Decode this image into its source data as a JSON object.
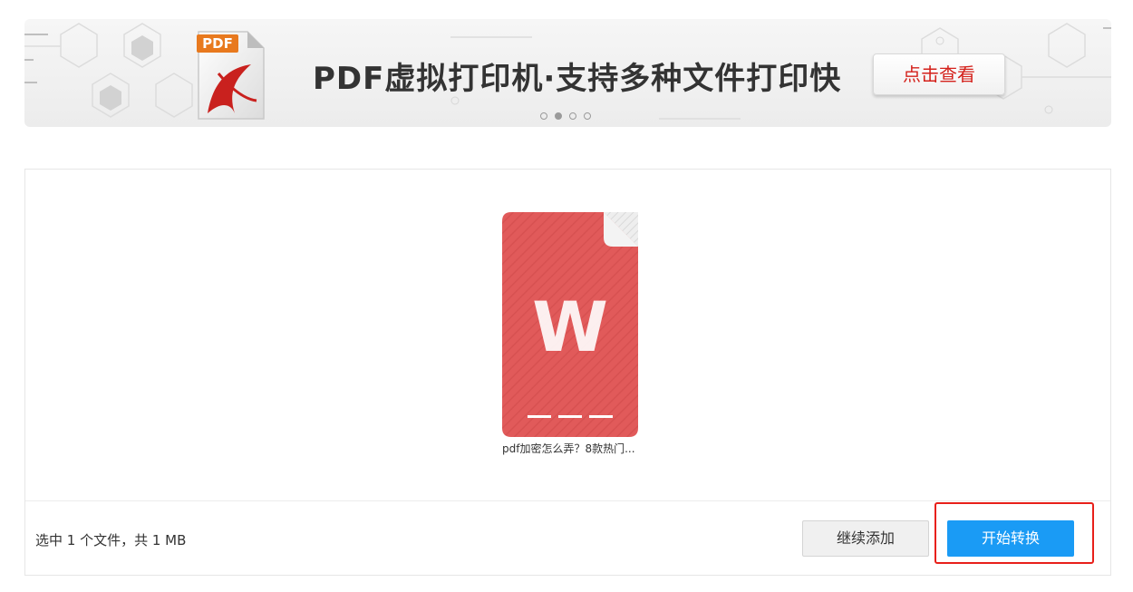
{
  "banner": {
    "title": "PDF虚拟打印机·支持多种文件打印快",
    "button_label": "点击查看",
    "icon_badge": "PDF",
    "carousel": {
      "count": 4,
      "active_index": 1
    }
  },
  "file": {
    "icon_letter": "W",
    "name": "pdf加密怎么弄？8款热门..."
  },
  "footer": {
    "status": "选中 1 个文件，共 1 MB",
    "add_label": "继续添加",
    "start_label": "开始转换"
  },
  "colors": {
    "file_icon": "#e15a5a",
    "primary": "#1a9bf5",
    "highlight": "#e8201a",
    "banner_button_text": "#d4211b"
  }
}
